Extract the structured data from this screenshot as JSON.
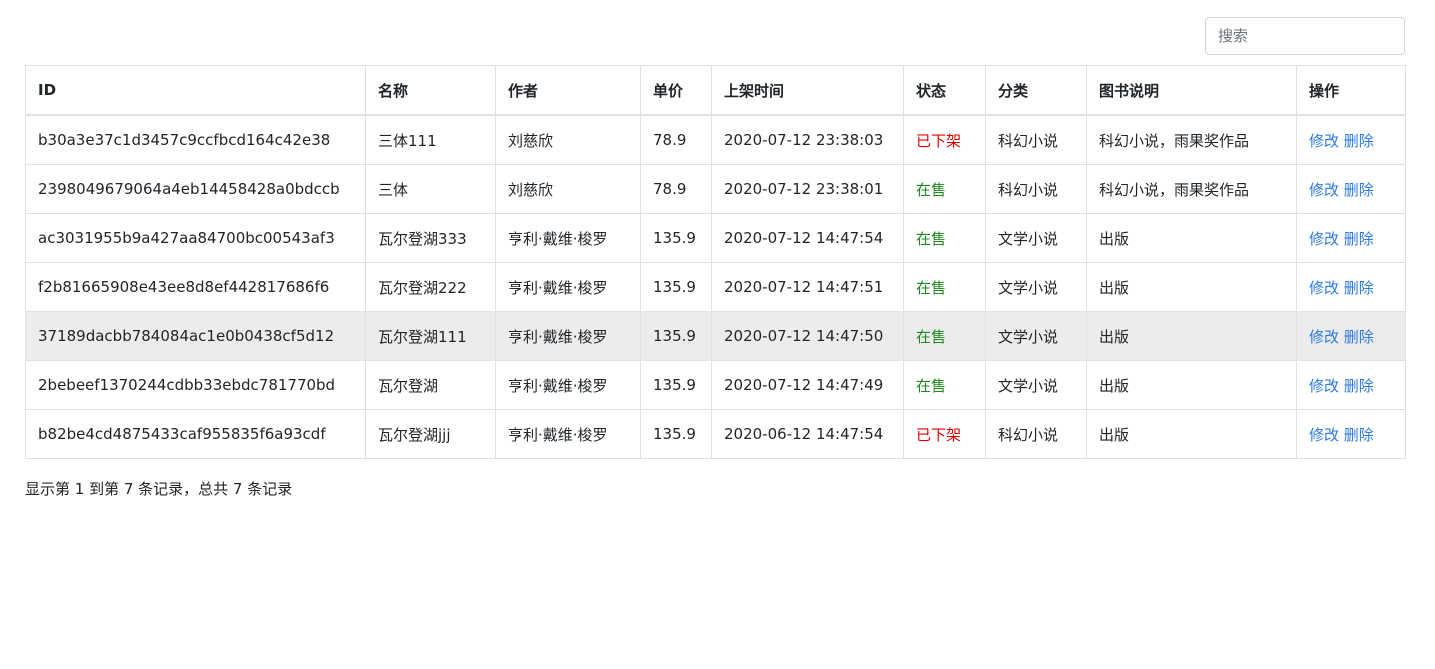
{
  "search": {
    "placeholder": "搜索"
  },
  "table": {
    "headers": [
      "ID",
      "名称",
      "作者",
      "单价",
      "上架时间",
      "状态",
      "分类",
      "图书说明",
      "操作"
    ],
    "rows": [
      {
        "id": "b30a3e37c1d3457c9ccfbcd164c42e38",
        "name": "三体111",
        "author": "刘慈欣",
        "price": "78.9",
        "time": "2020-07-12 23:38:03",
        "status": "已下架",
        "category": "科幻小说",
        "desc": "科幻小说，雨果奖作品"
      },
      {
        "id": "2398049679064a4eb14458428a0bdccb",
        "name": "三体",
        "author": "刘慈欣",
        "price": "78.9",
        "time": "2020-07-12 23:38:01",
        "status": "在售",
        "category": "科幻小说",
        "desc": "科幻小说，雨果奖作品"
      },
      {
        "id": "ac3031955b9a427aa84700bc00543af3",
        "name": "瓦尔登湖333",
        "author": "亨利·戴维·梭罗",
        "price": "135.9",
        "time": "2020-07-12 14:47:54",
        "status": "在售",
        "category": "文学小说",
        "desc": "出版"
      },
      {
        "id": "f2b81665908e43ee8d8ef442817686f6",
        "name": "瓦尔登湖222",
        "author": "亨利·戴维·梭罗",
        "price": "135.9",
        "time": "2020-07-12 14:47:51",
        "status": "在售",
        "category": "文学小说",
        "desc": "出版"
      },
      {
        "id": "37189dacbb784084ac1e0b0438cf5d12",
        "name": "瓦尔登湖111",
        "author": "亨利·戴维·梭罗",
        "price": "135.9",
        "time": "2020-07-12 14:47:50",
        "status": "在售",
        "category": "文学小说",
        "desc": "出版"
      },
      {
        "id": "2bebeef1370244cdbb33ebdc781770bd",
        "name": "瓦尔登湖",
        "author": "亨利·戴维·梭罗",
        "price": "135.9",
        "time": "2020-07-12 14:47:49",
        "status": "在售",
        "category": "文学小说",
        "desc": "出版"
      },
      {
        "id": "b82be4cd4875433caf955835f6a93cdf",
        "name": "瓦尔登湖jjj",
        "author": "亨利·戴维·梭罗",
        "price": "135.9",
        "time": "2020-06-12 14:47:54",
        "status": "已下架",
        "category": "科幻小说",
        "desc": "出版"
      }
    ],
    "actions": {
      "edit": "修改",
      "delete": "删除"
    }
  },
  "footer": {
    "summary": "显示第 1 到第 7 条记录，总共 7 条记录"
  },
  "colors": {
    "status_off": "#e00000",
    "status_on": "#1f8a1f",
    "link": "#2c7be5",
    "hover_row": "#ececec"
  }
}
